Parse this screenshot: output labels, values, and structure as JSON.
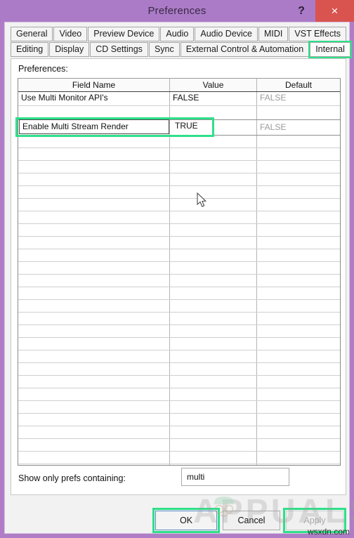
{
  "window": {
    "title": "Preferences",
    "help_label": "?",
    "close_label": "×",
    "frame_color": "#ab7bc7",
    "close_color": "#d9534f",
    "highlight_color": "#2ee08a"
  },
  "tabs": {
    "row1": [
      {
        "label": "General",
        "selected": false
      },
      {
        "label": "Video",
        "selected": false
      },
      {
        "label": "Preview Device",
        "selected": false
      },
      {
        "label": "Audio",
        "selected": false
      },
      {
        "label": "Audio Device",
        "selected": false
      },
      {
        "label": "MIDI",
        "selected": false
      },
      {
        "label": "VST Effects",
        "selected": false
      }
    ],
    "row2": [
      {
        "label": "Editing",
        "selected": false
      },
      {
        "label": "Display",
        "selected": false
      },
      {
        "label": "CD Settings",
        "selected": false
      },
      {
        "label": "Sync",
        "selected": false
      },
      {
        "label": "External Control & Automation",
        "selected": false
      },
      {
        "label": "Internal",
        "selected": true
      }
    ]
  },
  "panel": {
    "label": "Preferences:"
  },
  "grid": {
    "headers": {
      "field_name": "Field Name",
      "value": "Value",
      "default": "Default"
    },
    "rows": [
      {
        "field": "Use Multi Monitor API's",
        "value": "FALSE",
        "default": "FALSE"
      },
      {
        "field": "",
        "value": "",
        "default": ""
      },
      {
        "field": "Enable Multi Stream Render",
        "value": "TRUE",
        "default": "FALSE",
        "selected": true
      }
    ],
    "empty_row_count": 26
  },
  "filter": {
    "label": "Show only prefs containing:",
    "value": "multi",
    "placeholder": ""
  },
  "footer": {
    "ok": "OK",
    "cancel": "Cancel",
    "apply": "Apply"
  },
  "watermarks": {
    "appuals": "APPUALS",
    "wsxdn": "wsxdn.com"
  }
}
